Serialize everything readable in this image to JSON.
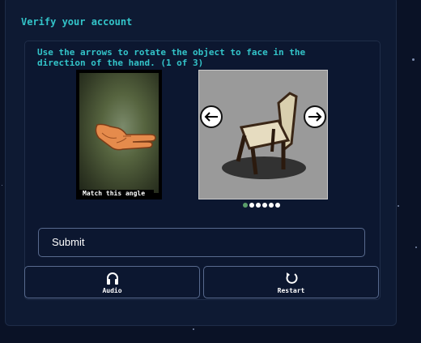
{
  "header": {
    "title": "Verify your account"
  },
  "challenge": {
    "instruction": "Use the arrows to rotate the object to face in the direction of the hand. (1 of 3)",
    "reference_caption": "Match this angle",
    "pager": {
      "total": 6,
      "current": 1
    }
  },
  "actions": {
    "submit_label": "Submit",
    "audio_label": "Audio",
    "restart_label": "Restart"
  },
  "icons": {
    "rotate_left": "arrow-left-icon",
    "rotate_right": "arrow-right-icon",
    "audio": "headphones-icon",
    "restart": "restart-icon"
  },
  "colors": {
    "accent": "#33c4c9",
    "background": "#0a1226",
    "panel": "#0e1a33",
    "button_border": "#586a8e",
    "pager_active": "#5a9e6a"
  }
}
